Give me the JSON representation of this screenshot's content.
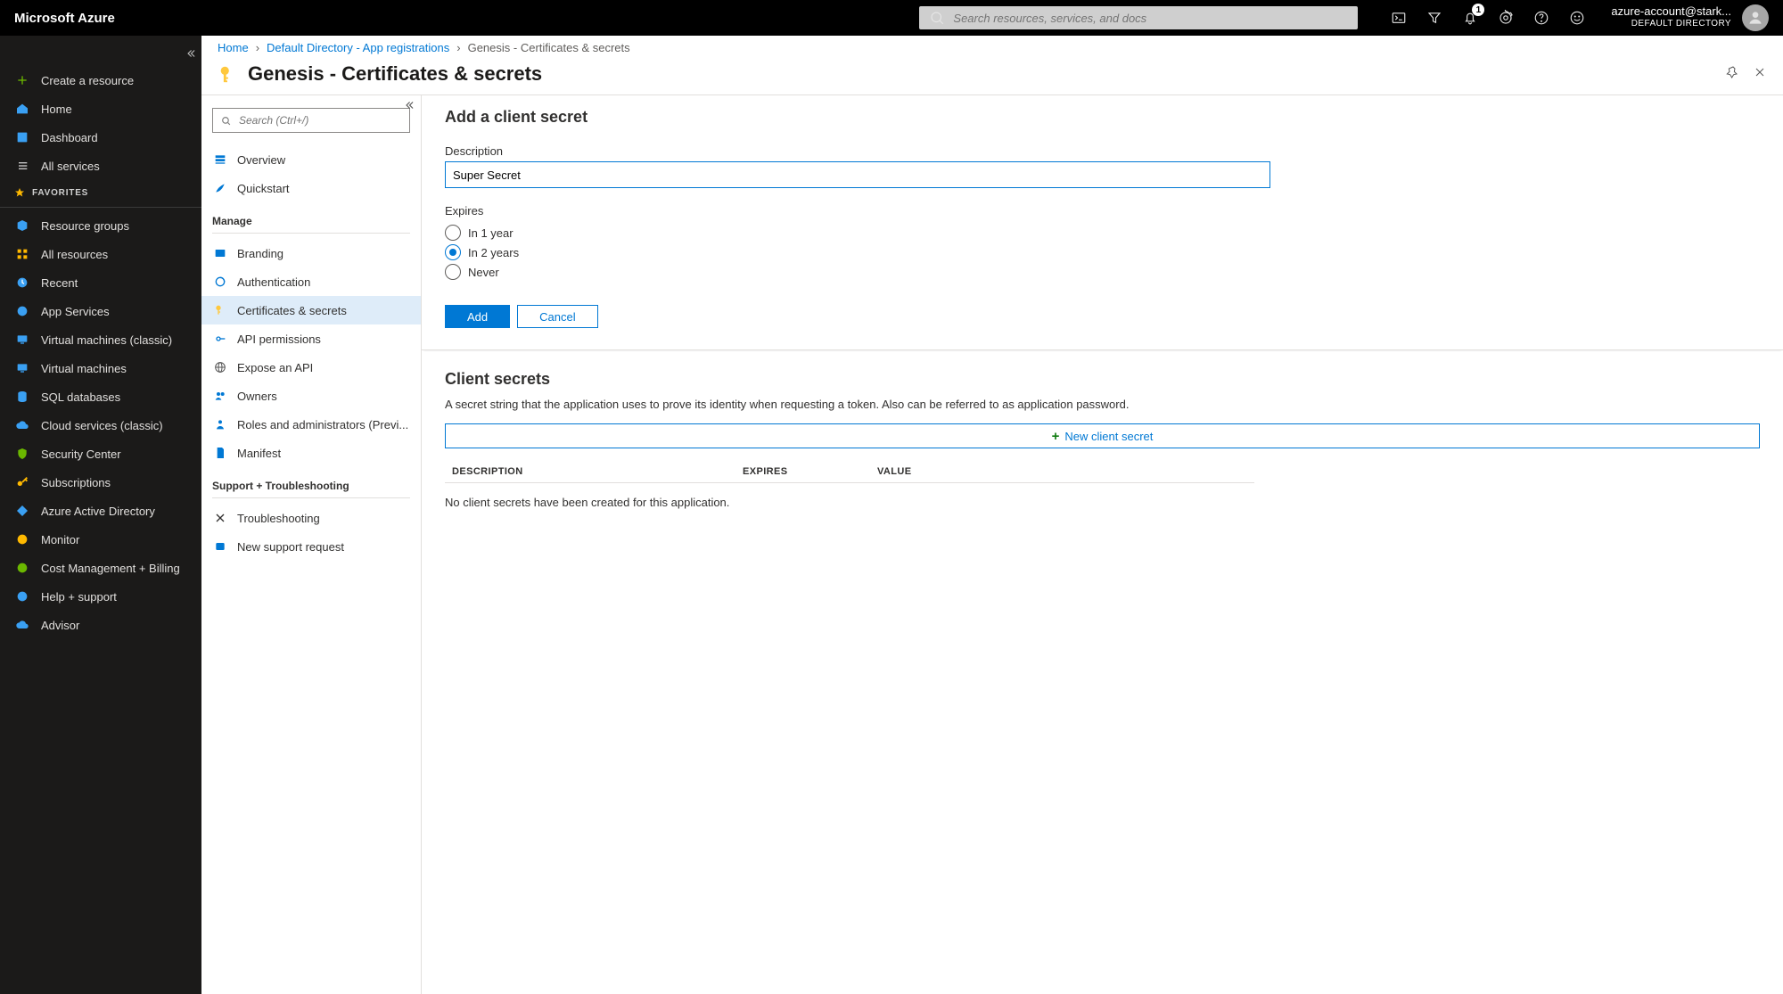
{
  "topbar": {
    "brand": "Microsoft Azure",
    "search_placeholder": "Search resources, services, and docs",
    "notification_count": "1",
    "account_email": "azure-account@stark...",
    "account_directory": "DEFAULT DIRECTORY"
  },
  "sidebar": {
    "primary": [
      {
        "label": "Create a resource"
      },
      {
        "label": "Home"
      },
      {
        "label": "Dashboard"
      },
      {
        "label": "All services"
      }
    ],
    "favorites_header": "FAVORITES",
    "favorites": [
      {
        "label": "Resource groups"
      },
      {
        "label": "All resources"
      },
      {
        "label": "Recent"
      },
      {
        "label": "App Services"
      },
      {
        "label": "Virtual machines (classic)"
      },
      {
        "label": "Virtual machines"
      },
      {
        "label": "SQL databases"
      },
      {
        "label": "Cloud services (classic)"
      },
      {
        "label": "Security Center"
      },
      {
        "label": "Subscriptions"
      },
      {
        "label": "Azure Active Directory"
      },
      {
        "label": "Monitor"
      },
      {
        "label": "Cost Management + Billing"
      },
      {
        "label": "Help + support"
      },
      {
        "label": "Advisor"
      }
    ]
  },
  "breadcrumb": {
    "items": [
      {
        "label": "Home",
        "link": true
      },
      {
        "label": "Default Directory - App registrations",
        "link": true
      },
      {
        "label": "Genesis - Certificates & secrets",
        "link": false
      }
    ],
    "sep": "›"
  },
  "page_title": "Genesis - Certificates & secrets",
  "blade": {
    "search_placeholder": "Search (Ctrl+/)",
    "top": [
      {
        "label": "Overview"
      },
      {
        "label": "Quickstart"
      }
    ],
    "section_manage": "Manage",
    "manage": [
      {
        "label": "Branding"
      },
      {
        "label": "Authentication"
      },
      {
        "label": "Certificates & secrets",
        "active": true
      },
      {
        "label": "API permissions"
      },
      {
        "label": "Expose an API"
      },
      {
        "label": "Owners"
      },
      {
        "label": "Roles and administrators (Previ..."
      },
      {
        "label": "Manifest"
      }
    ],
    "section_support": "Support + Troubleshooting",
    "support": [
      {
        "label": "Troubleshooting"
      },
      {
        "label": "New support request"
      }
    ]
  },
  "form": {
    "title": "Add a client secret",
    "description_label": "Description",
    "description_value": "Super Secret",
    "expires_label": "Expires",
    "expires_options": [
      {
        "label": "In 1 year",
        "checked": false
      },
      {
        "label": "In 2 years",
        "checked": true
      },
      {
        "label": "Never",
        "checked": false
      }
    ],
    "add_btn": "Add",
    "cancel_btn": "Cancel"
  },
  "secrets": {
    "title": "Client secrets",
    "description": "A secret string that the application uses to prove its identity when requesting a token. Also can be referred to as application password.",
    "new_btn": "New client secret",
    "columns": {
      "c0": "DESCRIPTION",
      "c1": "EXPIRES",
      "c2": "VALUE"
    },
    "empty": "No client secrets have been created for this application."
  }
}
